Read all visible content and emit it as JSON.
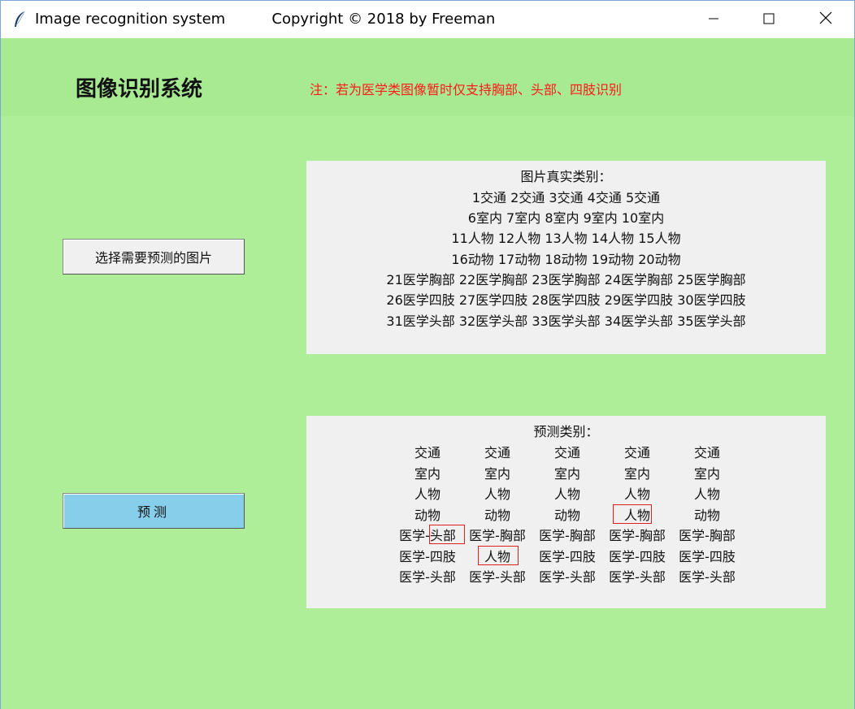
{
  "window": {
    "title": "Image recognition system          Copyright © 2018 by Freeman",
    "controls": {
      "minimize": "minimize-icon",
      "maximize": "maximize-icon",
      "close": "close-icon"
    }
  },
  "header": {
    "app_title": "图像识别系统",
    "note": "注：若为医学类图像暂时仅支持胸部、头部、四肢识别"
  },
  "buttons": {
    "choose_image": "选择需要预测的图片",
    "predict": "预测"
  },
  "true_panel": {
    "title": "图片真实类别：",
    "lines": [
      "1交通 2交通 3交通 4交通 5交通",
      "6室内 7室内 8室内 9室内 10室内",
      "11人物 12人物 13人物 14人物 15人物",
      "16动物 17动物 18动物 19动物 20动物",
      "21医学胸部 22医学胸部 23医学胸部 24医学胸部 25医学胸部",
      "26医学四肢 27医学四肢 28医学四肢 29医学四肢 30医学四肢",
      "31医学头部 32医学头部 33医学头部 34医学头部 35医学头部"
    ]
  },
  "pred_panel": {
    "title": "预测类别：",
    "rows": [
      [
        "交通",
        "交通",
        "交通",
        "交通",
        "交通"
      ],
      [
        "室内",
        "室内",
        "室内",
        "室内",
        "室内"
      ],
      [
        "人物",
        "人物",
        "人物",
        "人物",
        "人物"
      ],
      [
        "动物",
        "动物",
        "动物",
        "人物",
        "动物"
      ],
      [
        "医学-头部",
        "医学-胸部",
        "医学-胸部",
        "医学-胸部",
        "医学-胸部"
      ],
      [
        "医学-四肢",
        "人物",
        "医学-四肢",
        "医学-四肢",
        "医学-四肢"
      ],
      [
        "医学-头部",
        "医学-头部",
        "医学-头部",
        "医学-头部",
        "医学-头部"
      ]
    ],
    "misclassified": [
      {
        "row": 3,
        "col": 3
      },
      {
        "row": 4,
        "col": 0
      },
      {
        "row": 5,
        "col": 1
      }
    ]
  },
  "colors": {
    "background": "#aeee98",
    "panel": "#f0f0f0",
    "note_text": "#ff1a1a",
    "predict_button": "#87ceeb",
    "highlight_border": "#e0201d"
  }
}
